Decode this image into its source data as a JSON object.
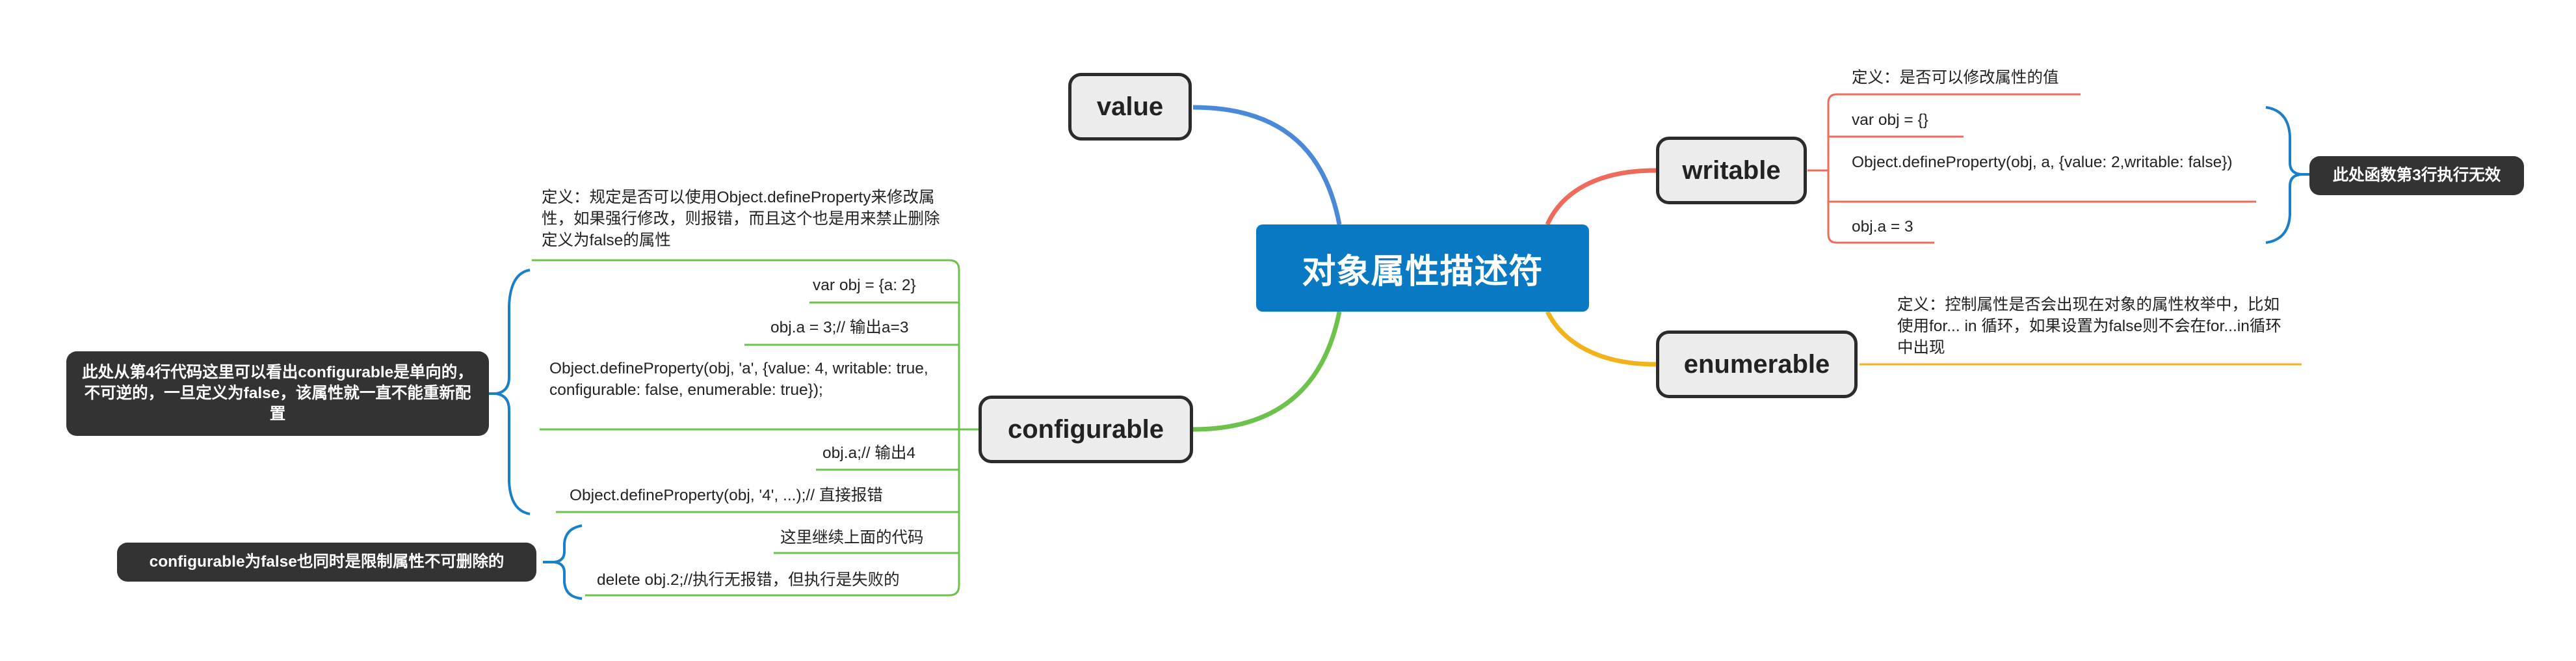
{
  "colors": {
    "root": "#0a79c4",
    "value": "#4a89d9",
    "writable": "#ee6a5a",
    "enumerable": "#f2b21c",
    "configurable": "#6cc24a",
    "note_bg": "#333333"
  },
  "root": {
    "label": "对象属性描述符"
  },
  "topics": {
    "value": "value",
    "writable": "writable",
    "enumerable": "enumerable",
    "configurable": "configurable"
  },
  "writable": {
    "definition": "定义：是否可以修改属性的值",
    "items": [
      "var obj = {}",
      "Object.defineProperty(obj, a, {value: 2,writable: false})",
      "obj.a = 3"
    ],
    "note": "此处函数第3行执行无效"
  },
  "enumerable": {
    "definition": "定义：控制属性是否会出现在对象的属性枚举中，比如使用for... in 循环，如果设置为false则不会在for...in循环中出现"
  },
  "configurable": {
    "definition": "定义：规定是否可以使用Object.defineProperty来修改属性，如果强行修改，则报错，而且这个也是用来禁止删除定义为false的属性",
    "items": [
      "var obj = {a: 2}",
      "obj.a = 3;// 输出a=3",
      "Object.defineProperty(obj, 'a', {value: 4, writable: true, configurable: false, enumerable: true});",
      "obj.a;// 输出4",
      "Object.defineProperty(obj, '4', ...);// 直接报错"
    ],
    "note1": "此处从第4行代码这里可以看出configurable是单向的，不可逆的，一旦定义为false，该属性就一直不能重新配置",
    "items2": [
      "这里继续上面的代码",
      "delete obj.2;//执行无报错，但执行是失败的"
    ],
    "note2": "configurable为false也同时是限制属性不可删除的"
  }
}
